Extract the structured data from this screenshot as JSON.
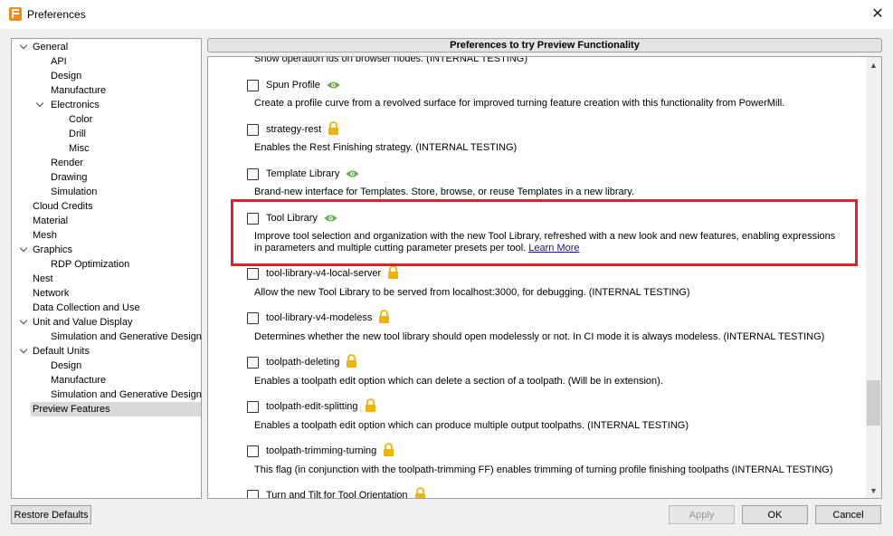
{
  "window": {
    "title": "Preferences"
  },
  "tree": {
    "items": [
      {
        "label": "General",
        "expandable": true
      },
      {
        "label": "API"
      },
      {
        "label": "Design"
      },
      {
        "label": "Manufacture"
      },
      {
        "label": "Electronics",
        "expandable": true
      },
      {
        "label": "Color"
      },
      {
        "label": "Drill"
      },
      {
        "label": "Misc"
      },
      {
        "label": "Render"
      },
      {
        "label": "Drawing"
      },
      {
        "label": "Simulation"
      },
      {
        "label": "Cloud Credits"
      },
      {
        "label": "Material"
      },
      {
        "label": "Mesh"
      },
      {
        "label": "Graphics",
        "expandable": true
      },
      {
        "label": "RDP Optimization"
      },
      {
        "label": "Nest"
      },
      {
        "label": "Network"
      },
      {
        "label": "Data Collection and Use"
      },
      {
        "label": "Unit and Value Display",
        "expandable": true
      },
      {
        "label": "Simulation and Generative Design"
      },
      {
        "label": "Default Units",
        "expandable": true
      },
      {
        "label": "Design"
      },
      {
        "label": "Manufacture"
      },
      {
        "label": "Simulation and Generative Design"
      },
      {
        "label": "Preview Features",
        "selected": true
      }
    ]
  },
  "panel": {
    "header": "Preferences to try Preview Functionality",
    "top_cut_text": "Show operation ids on browser nodes. (INTERNAL TESTING)",
    "features": [
      {
        "name": "Spun Profile",
        "badge": "eye-icon",
        "desc": "Create a profile curve from a revolved surface for improved turning feature creation with this functionality from PowerMill."
      },
      {
        "name": "strategy-rest",
        "badge": "lock-icon",
        "desc": "Enables the Rest Finishing strategy. (INTERNAL TESTING)"
      },
      {
        "name": "Template Library",
        "badge": "eye-icon",
        "desc": "Brand-new interface for Templates. Store, browse, or reuse Templates in a new library."
      },
      {
        "name": "Tool Library",
        "badge": "eye-icon",
        "desc": "Improve tool selection and organization with the new Tool Library, refreshed with a new look and new features, enabling expressions",
        "desc2": "in parameters and multiple cutting parameter presets per tool.",
        "link": "Learn More"
      },
      {
        "name": "tool-library-v4-local-server",
        "badge": "lock-icon",
        "desc": "Allow the new Tool Library to be served from localhost:3000, for debugging. (INTERNAL TESTING)"
      },
      {
        "name": "tool-library-v4-modeless",
        "badge": "lock-icon",
        "desc": "Determines whether the new tool library should open modelessly or not. In CI mode it is always modeless. (INTERNAL TESTING)"
      },
      {
        "name": "toolpath-deleting",
        "badge": "lock-icon",
        "desc": "Enables a toolpath edit option which can delete a section of a toolpath. (Will be in extension)."
      },
      {
        "name": "toolpath-edit-splitting",
        "badge": "lock-icon",
        "desc": "Enables a toolpath edit option which can produce multiple output toolpaths. (INTERNAL TESTING)"
      },
      {
        "name": "toolpath-trimming-turning",
        "badge": "lock-icon",
        "desc": "This flag (in conjunction with the toolpath-trimming FF) enables trimming of turning profile finishing toolpaths (INTERNAL TESTING)"
      },
      {
        "name": "Turn and Tilt for Tool Orientation",
        "badge": "lock-icon",
        "desc": ""
      }
    ]
  },
  "buttons": {
    "restore": "Restore Defaults",
    "apply": "Apply",
    "ok": "OK",
    "cancel": "Cancel"
  },
  "colors": {
    "highlight": "#e0202a",
    "eye": "#6aa84f",
    "lock": "#f0b400"
  }
}
